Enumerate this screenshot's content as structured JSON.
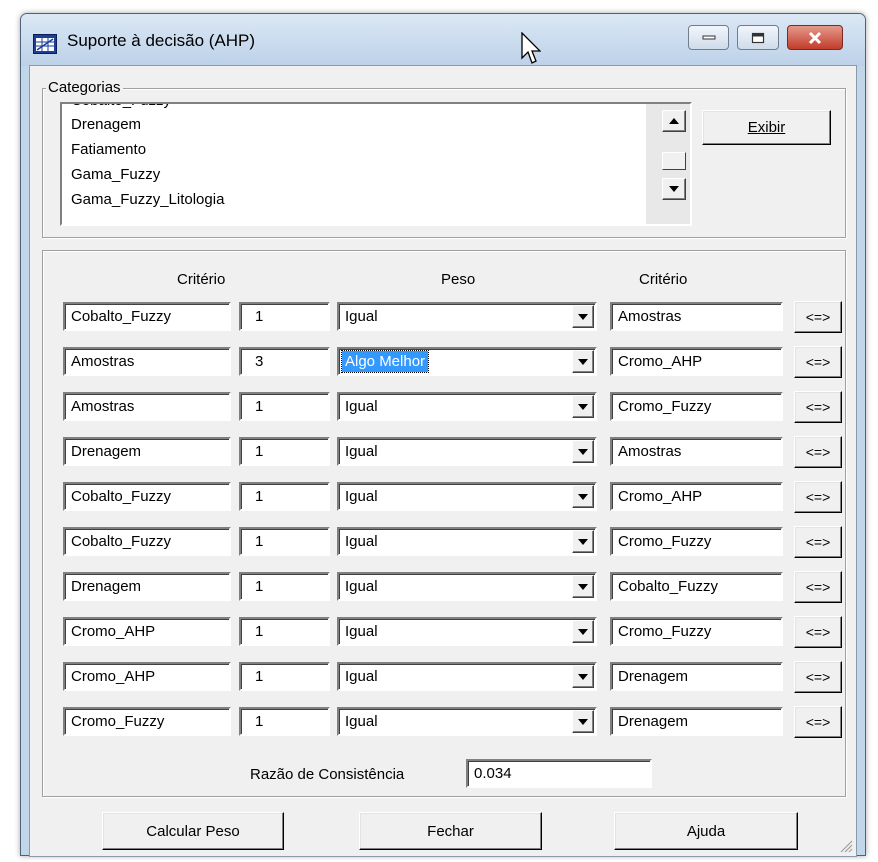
{
  "window": {
    "title": "Suporte à decisão (AHP)"
  },
  "categorias": {
    "label": "Categorias",
    "items": [
      "Drenagem",
      "Fatiamento",
      "Gama_Fuzzy",
      "Gama_Fuzzy_Litologia"
    ],
    "exibir_label": "Exibir"
  },
  "table": {
    "header_criterio_left": "Critério",
    "header_peso": "Peso",
    "header_criterio_right": "Critério",
    "swap_label": "<=>",
    "rows": [
      {
        "left": "Cobalto_Fuzzy",
        "value": "1",
        "peso": "Igual",
        "right": "Amostras"
      },
      {
        "left": "Amostras",
        "value": "3",
        "peso": "Algo Melhor",
        "right": "Cromo_AHP"
      },
      {
        "left": "Amostras",
        "value": "1",
        "peso": "Igual",
        "right": "Cromo_Fuzzy"
      },
      {
        "left": "Drenagem",
        "value": "1",
        "peso": "Igual",
        "right": "Amostras"
      },
      {
        "left": "Cobalto_Fuzzy",
        "value": "1",
        "peso": "Igual",
        "right": "Cromo_AHP"
      },
      {
        "left": "Cobalto_Fuzzy",
        "value": "1",
        "peso": "Igual",
        "right": "Cromo_Fuzzy"
      },
      {
        "left": "Drenagem",
        "value": "1",
        "peso": "Igual",
        "right": "Cobalto_Fuzzy"
      },
      {
        "left": "Cromo_AHP",
        "value": "1",
        "peso": "Igual",
        "right": "Cromo_Fuzzy"
      },
      {
        "left": "Cromo_AHP",
        "value": "1",
        "peso": "Igual",
        "right": "Drenagem"
      },
      {
        "left": "Cromo_Fuzzy",
        "value": "1",
        "peso": "Igual",
        "right": "Drenagem"
      }
    ]
  },
  "consistency": {
    "label": "Razão de Consistência",
    "value": "0.034"
  },
  "buttons": {
    "calcular": "Calcular Peso",
    "fechar": "Fechar",
    "ajuda": "Ajuda"
  },
  "colors": {
    "selection": "#3399ff",
    "dialog_bg": "#f0f0f0",
    "titlebar": "#c2d6ea",
    "close_button": "#c33c2b"
  },
  "icons": [
    "app-grid-icon",
    "mouse-cursor-icon",
    "minimize-icon",
    "maximize-icon",
    "close-icon",
    "scroll-up-icon",
    "scroll-down-icon",
    "dropdown-arrow-icon",
    "resize-grip-icon"
  ]
}
